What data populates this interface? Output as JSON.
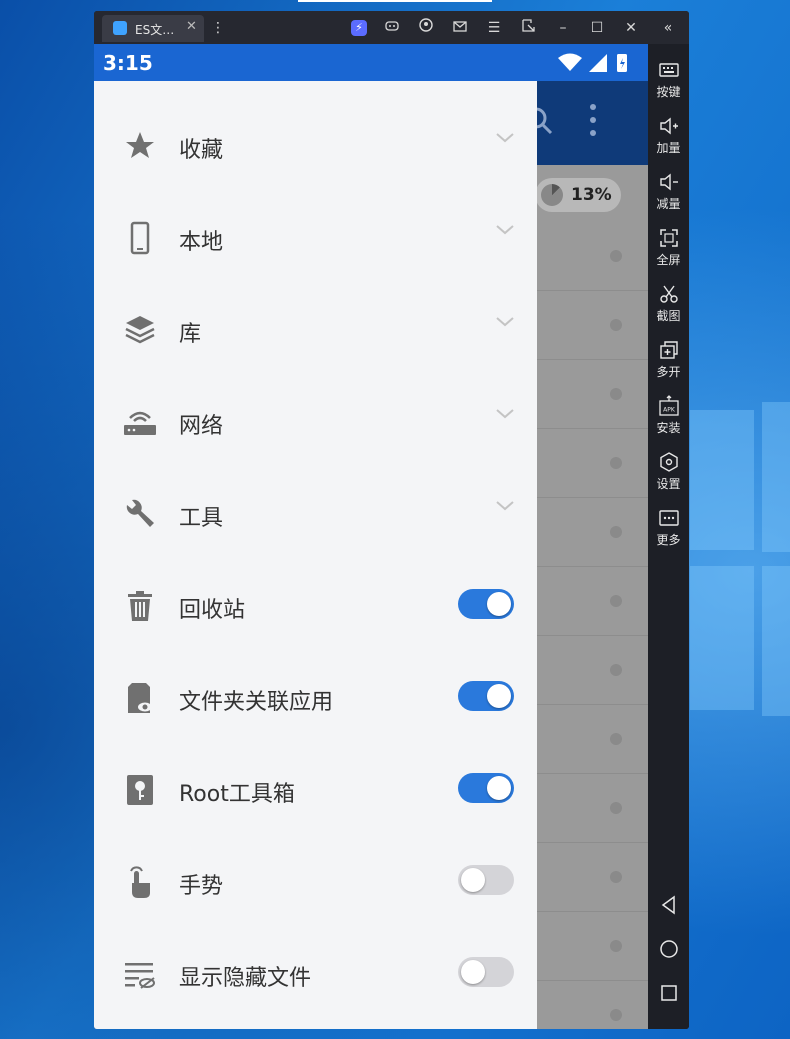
{
  "titlebar": {
    "tab_title": "ES文…",
    "tab_close": "✕",
    "buttons": [
      "tab-menu",
      "boost",
      "gamepad",
      "account",
      "mail",
      "menu",
      "expand",
      "minimize",
      "maximize",
      "close",
      "collapse"
    ]
  },
  "statusbar": {
    "time": "3:15",
    "icons": "▾◢▮"
  },
  "background_app": {
    "storage_percent": "13%"
  },
  "drawer": {
    "items": [
      {
        "label": "收藏",
        "icon": "star-icon",
        "control": "chevron"
      },
      {
        "label": "本地",
        "icon": "phone-icon",
        "control": "chevron"
      },
      {
        "label": "库",
        "icon": "layers-icon",
        "control": "chevron"
      },
      {
        "label": "网络",
        "icon": "router-icon",
        "control": "chevron"
      },
      {
        "label": "工具",
        "icon": "wrench-icon",
        "control": "chevron"
      },
      {
        "label": "回收站",
        "icon": "trash-icon",
        "control": "toggle",
        "on": true
      },
      {
        "label": "文件夹关联应用",
        "icon": "folder-app-icon",
        "control": "toggle",
        "on": true
      },
      {
        "label": "Root工具箱",
        "icon": "root-key-icon",
        "control": "toggle",
        "on": true
      },
      {
        "label": "手势",
        "icon": "gesture-hand-icon",
        "control": "toggle",
        "on": false
      },
      {
        "label": "显示隐藏文件",
        "icon": "hidden-files-icon",
        "control": "toggle",
        "on": false
      }
    ]
  },
  "sidebar": {
    "buttons": [
      {
        "label": "按键",
        "icon": "keyboard-icon"
      },
      {
        "label": "加量",
        "icon": "volume-up-icon"
      },
      {
        "label": "减量",
        "icon": "volume-down-icon"
      },
      {
        "label": "全屏",
        "icon": "fullscreen-icon"
      },
      {
        "label": "截图",
        "icon": "scissors-icon"
      },
      {
        "label": "多开",
        "icon": "multi-instance-icon"
      },
      {
        "label": "安装",
        "icon": "apk-install-icon"
      },
      {
        "label": "设置",
        "icon": "settings-hex-icon"
      },
      {
        "label": "更多",
        "icon": "more-icon"
      }
    ],
    "nav": [
      "back-icon",
      "home-icon",
      "recents-icon"
    ]
  },
  "colors": {
    "accent": "#2a79dc",
    "statusbar": "#1a66d2",
    "header": "#0f3a79",
    "drawer": "#f4f5f7"
  }
}
